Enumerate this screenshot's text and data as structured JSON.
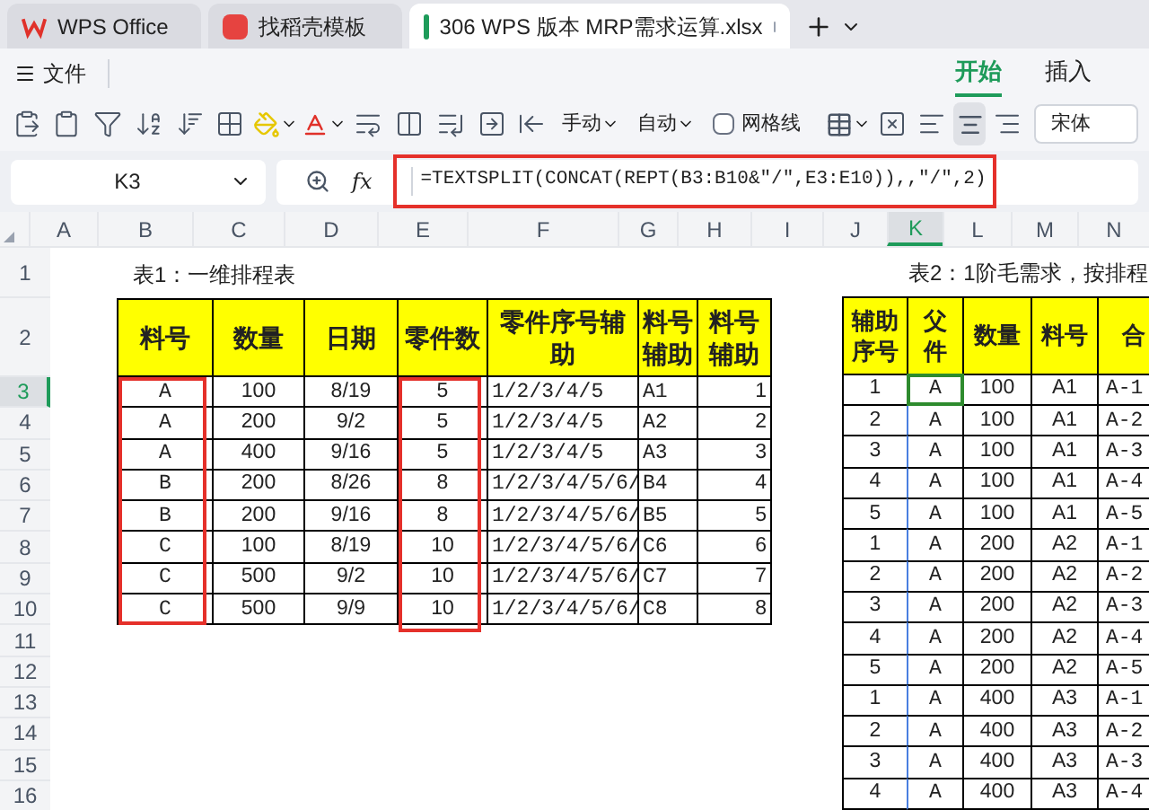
{
  "tabs": [
    {
      "label": "WPS Office",
      "kind": "home",
      "selected": false
    },
    {
      "label": "找稻壳模板",
      "kind": "template",
      "selected": false
    },
    {
      "label": "306 WPS 版本 MRP需求运算.xlsx",
      "kind": "sheet",
      "selected": true
    }
  ],
  "menu": {
    "file": "文件",
    "ribbon_tabs": [
      {
        "label": "开始",
        "selected": true
      },
      {
        "label": "插入",
        "selected": false
      }
    ]
  },
  "toolbar": {
    "row_height": "手动",
    "col_width": "自动",
    "gridlines": {
      "label": "网格线",
      "checked": false
    },
    "font": "宋体"
  },
  "formula_bar": {
    "cell": "K3",
    "fx": "fx",
    "formula": "=TEXTSPLIT(CONCAT(REPT(B3:B10&\"/\",E3:E10)),,\"/\",2)",
    "highlighted": true
  },
  "sheet": {
    "columns": [
      {
        "label": "A",
        "selected": false
      },
      {
        "label": "B",
        "selected": false
      },
      {
        "label": "C",
        "selected": false
      },
      {
        "label": "D",
        "selected": false
      },
      {
        "label": "E",
        "selected": false
      },
      {
        "label": "F",
        "selected": false
      },
      {
        "label": "G",
        "selected": false
      },
      {
        "label": "H",
        "selected": false
      },
      {
        "label": "I",
        "selected": false
      },
      {
        "label": "J",
        "selected": false
      },
      {
        "label": "K",
        "selected": true
      },
      {
        "label": "L",
        "selected": false
      },
      {
        "label": "M",
        "selected": false
      },
      {
        "label": "N",
        "selected": false
      }
    ],
    "rows": [
      {
        "label": "1",
        "selected": false
      },
      {
        "label": "2",
        "selected": false
      },
      {
        "label": "3",
        "selected": true
      },
      {
        "label": "4",
        "selected": false
      },
      {
        "label": "5",
        "selected": false
      },
      {
        "label": "6",
        "selected": false
      },
      {
        "label": "7",
        "selected": false
      },
      {
        "label": "8",
        "selected": false
      },
      {
        "label": "9",
        "selected": false
      },
      {
        "label": "10",
        "selected": false
      },
      {
        "label": "11",
        "selected": false
      },
      {
        "label": "12",
        "selected": false
      },
      {
        "label": "13",
        "selected": false
      },
      {
        "label": "14",
        "selected": false
      },
      {
        "label": "15",
        "selected": false
      },
      {
        "label": "16",
        "selected": false
      }
    ],
    "table1": {
      "title": "表1：一维排程表",
      "columns": [
        {
          "header": "料号",
          "highlighted": true
        },
        {
          "header": "数量",
          "highlighted": false
        },
        {
          "header": "日期",
          "highlighted": false
        },
        {
          "header": "零件数",
          "highlighted": true
        },
        {
          "header": "零件序号辅助",
          "highlighted": false
        },
        {
          "header": "料号辅助",
          "highlighted": false
        },
        {
          "header": "料号辅助",
          "highlighted": false
        }
      ],
      "rows": [
        [
          "A",
          "100",
          "8/19",
          "5",
          "1/2/3/4/5",
          "A1",
          "1"
        ],
        [
          "A",
          "200",
          "9/2",
          "5",
          "1/2/3/4/5",
          "A2",
          "2"
        ],
        [
          "A",
          "400",
          "9/16",
          "5",
          "1/2/3/4/5",
          "A3",
          "3"
        ],
        [
          "B",
          "200",
          "8/26",
          "8",
          "1/2/3/4/5/6/",
          "B4",
          "4"
        ],
        [
          "B",
          "200",
          "9/16",
          "8",
          "1/2/3/4/5/6/",
          "B5",
          "5"
        ],
        [
          "C",
          "100",
          "8/19",
          "10",
          "1/2/3/4/5/6/",
          "C6",
          "6"
        ],
        [
          "C",
          "500",
          "9/2",
          "10",
          "1/2/3/4/5/6/",
          "C7",
          "7"
        ],
        [
          "C",
          "500",
          "9/9",
          "10",
          "1/2/3/4/5/6/",
          "C8",
          "8"
        ]
      ]
    },
    "table2": {
      "title": "表2：1阶毛需求，按排程",
      "columns": [
        "辅助序号",
        "父件",
        "数量",
        "料号",
        "合"
      ],
      "rows": [
        [
          "1",
          "A",
          "100",
          "A1",
          "A-1"
        ],
        [
          "2",
          "A",
          "100",
          "A1",
          "A-2"
        ],
        [
          "3",
          "A",
          "100",
          "A1",
          "A-3"
        ],
        [
          "4",
          "A",
          "100",
          "A1",
          "A-4"
        ],
        [
          "5",
          "A",
          "100",
          "A1",
          "A-5"
        ],
        [
          "1",
          "A",
          "200",
          "A2",
          "A-1"
        ],
        [
          "2",
          "A",
          "200",
          "A2",
          "A-2"
        ],
        [
          "3",
          "A",
          "200",
          "A2",
          "A-3"
        ],
        [
          "4",
          "A",
          "200",
          "A2",
          "A-4"
        ],
        [
          "5",
          "A",
          "200",
          "A2",
          "A-5"
        ],
        [
          "1",
          "A",
          "400",
          "A3",
          "A-1"
        ],
        [
          "2",
          "A",
          "400",
          "A3",
          "A-2"
        ],
        [
          "3",
          "A",
          "400",
          "A3",
          "A-3"
        ],
        [
          "4",
          "A",
          "400",
          "A3",
          "A-4"
        ]
      ]
    }
  }
}
